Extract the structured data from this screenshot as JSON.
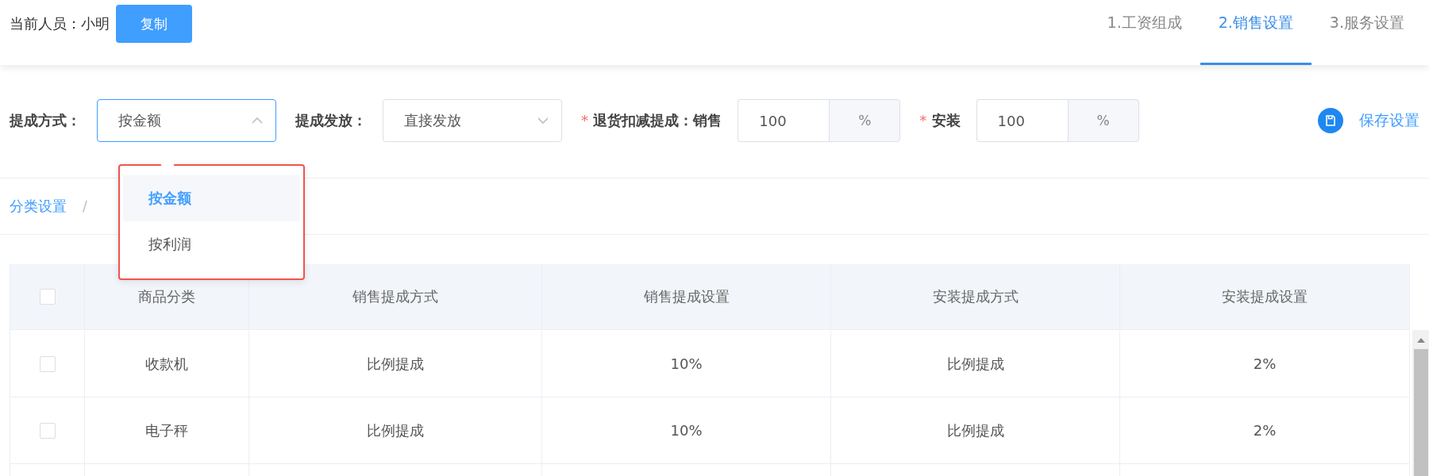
{
  "header": {
    "person_label": "当前人员：小明",
    "copy_button": "复制"
  },
  "steps": [
    {
      "label": "1.工资组成",
      "selected": false
    },
    {
      "label": "2.销售设置",
      "selected": true
    },
    {
      "label": "3.服务设置",
      "selected": false
    }
  ],
  "form": {
    "items": [
      {
        "kind": "select",
        "label": "提成方式：",
        "value": "按金额",
        "open": true
      },
      {
        "kind": "select",
        "label": "提成发放：",
        "value": "直接发放",
        "open": false
      },
      {
        "kind": "percent",
        "required_mark": "*",
        "label": "退货扣减提成：销售",
        "value": "100",
        "unit": "%"
      },
      {
        "kind": "percent",
        "required_mark": "*",
        "label": "安装",
        "value": "100",
        "unit": "%"
      }
    ],
    "save_button": "保存设置"
  },
  "dropdown": {
    "options": [
      {
        "label": "按金额",
        "selected": true
      },
      {
        "label": "按利润",
        "selected": false
      }
    ]
  },
  "breadcrumb": {
    "items": [
      "分类设置"
    ],
    "separator": "/"
  },
  "table": {
    "header_checked": false,
    "columns": [
      "商品分类",
      "销售提成方式",
      "销售提成设置",
      "安装提成方式",
      "安装提成设置"
    ],
    "rows": [
      {
        "checked": false,
        "cells": [
          "收款机",
          "比例提成",
          "10%",
          "比例提成",
          "2%"
        ]
      },
      {
        "checked": false,
        "cells": [
          "电子秤",
          "比例提成",
          "10%",
          "比例提成",
          "2%"
        ]
      }
    ]
  }
}
